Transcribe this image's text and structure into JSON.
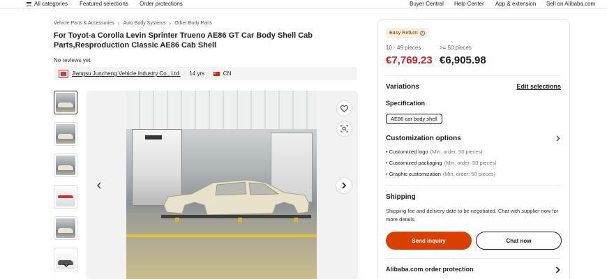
{
  "topnav": {
    "categories": "All categories",
    "featured": "Featured selections",
    "protections": "Order protections",
    "buyer_central": "Buyer Central",
    "help_center": "Help Center",
    "app_extension": "App & extension",
    "sell": "Sell on Alibaba.com"
  },
  "breadcrumb": [
    "Vehicle Parts & Accessories",
    "Auto Body Systems",
    "Other Body Parts"
  ],
  "product": {
    "title": "For Toyot-a Corolla Levin Sprinter Trueno AE86 GT Car Body Shell Cab Parts,Resproduction Classic AE86 Cab Shell",
    "reviews": "No reviews yet"
  },
  "supplier": {
    "name": "Jiangsu Juncheng Vehicle Industry Co., Ltd.",
    "years": "14 yrs",
    "country": "CN"
  },
  "gallery": {
    "thumbnail_count": 6,
    "active_index": 0
  },
  "panel": {
    "badge": "Easy Return",
    "tiers": [
      {
        "qty": "10 - 49 pieces",
        "price": "€7,769.23"
      },
      {
        "qty": ">= 50 pieces",
        "price": "€6,905.98"
      }
    ],
    "variations_title": "Variations",
    "edit_selections": "Edit selections",
    "spec_label": "Specification",
    "spec_option": "AE86 car body shell",
    "customization_title": "Customization options",
    "customization": [
      {
        "name": "Customized logo",
        "min": "(Min. order: 50 pieces)"
      },
      {
        "name": "Customized packaging",
        "min": "(Min. order: 50 pieces)"
      },
      {
        "name": "Graphic customization",
        "min": "(Min. order: 50 pieces)"
      }
    ],
    "shipping_title": "Shipping",
    "shipping_text": "Shipping fee and delivery date to be negotiated. Chat with supplier now for more details.",
    "send_inquiry": "Send inquiry",
    "chat_now": "Chat now",
    "protection": "Alibaba.com order protection"
  },
  "colors": {
    "accent": "#d94000",
    "price_red": "#cc1f1f",
    "badge_text": "#c05b16"
  }
}
